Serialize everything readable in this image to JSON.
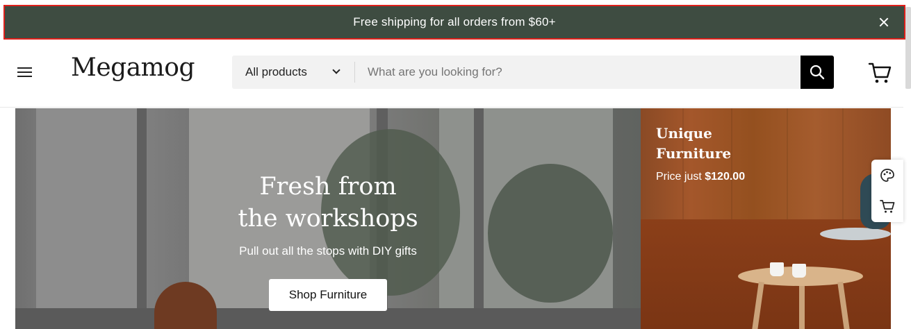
{
  "announcement": {
    "text": "Free shipping for all orders from $60+",
    "close_icon": "close-icon"
  },
  "header": {
    "menu_icon": "hamburger-menu-icon",
    "logo": "Megamog",
    "search": {
      "category": "All products",
      "placeholder": "What are you looking for?",
      "value": ""
    },
    "cart_icon": "cart-icon"
  },
  "hero": {
    "title": "Fresh from\nthe workshops",
    "subtitle": "Pull out all the stops with DIY gifts",
    "button": "Shop Furniture"
  },
  "promo": {
    "title": "Unique\nFurniture",
    "price_prefix": "Price just",
    "price": "$120.00"
  },
  "floating_tools": {
    "items": [
      "palette-icon",
      "cart-icon"
    ]
  },
  "colors": {
    "announcement_bg": "#3e4c41",
    "highlight_border": "#e0201b",
    "search_bg": "#f2f2f2",
    "search_button": "#000000"
  }
}
